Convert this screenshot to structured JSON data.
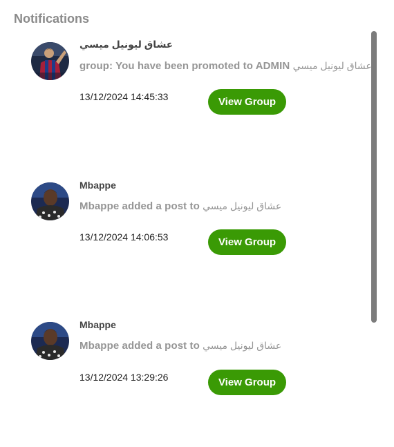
{
  "panel": {
    "title": "Notifications"
  },
  "notifications": [
    {
      "sender": "عشاق ليونيل ميسي",
      "message_prefix": "group: You have been promoted to ADMIN ",
      "message_group": "عشاق ليونيل ميسي",
      "timestamp": "13/12/2024 14:45:33",
      "button_label": "View Group",
      "avatar_icon": "messi-avatar"
    },
    {
      "sender": "Mbappe",
      "message_prefix": "Mbappe added a post to ",
      "message_group": "عشاق ليونيل ميسي",
      "timestamp": "13/12/2024 14:06:53",
      "button_label": "View Group",
      "avatar_icon": "mbappe-avatar"
    },
    {
      "sender": "Mbappe",
      "message_prefix": "Mbappe added a post to ",
      "message_group": "عشاق ليونيل ميسي",
      "timestamp": "13/12/2024 13:29:26",
      "button_label": "View Group",
      "avatar_icon": "mbappe-avatar"
    }
  ],
  "colors": {
    "accent_button": "#3a9a05",
    "title_gray": "#8a8a8a",
    "message_gray": "#959595",
    "scrollbar": "#7c7c7c"
  }
}
